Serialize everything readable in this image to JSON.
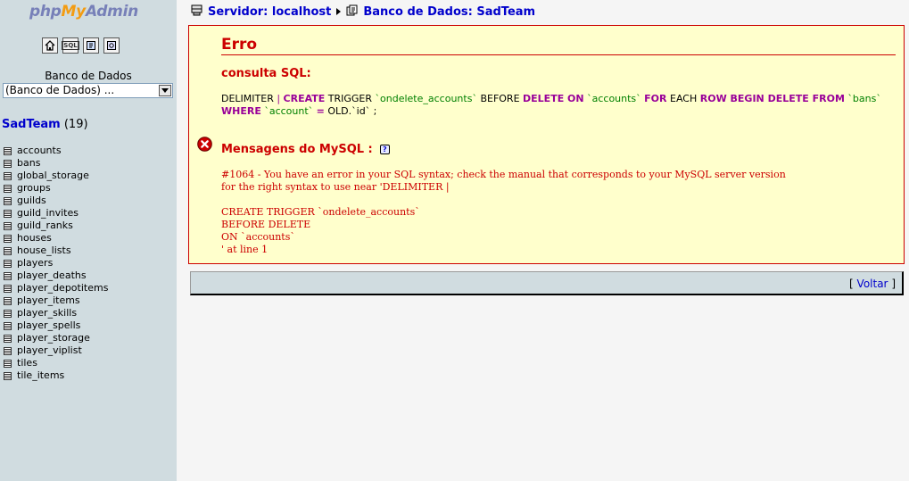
{
  "sidebar": {
    "logo": {
      "php": "php",
      "my": "My",
      "admin": "Admin"
    },
    "icons": [
      {
        "name": "home-icon",
        "label": ""
      },
      {
        "name": "sql-icon",
        "label": "SQL"
      },
      {
        "name": "query-window-icon",
        "label": ""
      },
      {
        "name": "docs-icon",
        "label": ""
      }
    ],
    "db_label": "Banco de Dados",
    "db_select_value": "(Banco de Dados) ...",
    "current_db_name": "SadTeam",
    "current_db_count": "(19)",
    "tables": [
      "accounts",
      "bans",
      "global_storage",
      "groups",
      "guilds",
      "guild_invites",
      "guild_ranks",
      "houses",
      "house_lists",
      "players",
      "player_deaths",
      "player_depotitems",
      "player_items",
      "player_skills",
      "player_spells",
      "player_storage",
      "player_viplist",
      "tiles",
      "tile_items"
    ]
  },
  "breadcrumb": {
    "server": "Servidor: localhost",
    "database": "Banco de Dados: SadTeam"
  },
  "error": {
    "title": "Erro",
    "sql_label": "consulta SQL:",
    "query_tokens": [
      {
        "t": "DELIMITER ",
        "c": "plain"
      },
      {
        "t": "| ",
        "c": "pipe"
      },
      {
        "t": "CREATE",
        "c": "kw"
      },
      {
        "t": " TRIGGER ",
        "c": "plain"
      },
      {
        "t": "`ondelete_accounts`",
        "c": "str"
      },
      {
        "t": " BEFORE ",
        "c": "plain"
      },
      {
        "t": "DELETE ON",
        "c": "kw"
      },
      {
        "t": " ",
        "c": "plain"
      },
      {
        "t": "`accounts`",
        "c": "str"
      },
      {
        "t": " ",
        "c": "plain"
      },
      {
        "t": "FOR",
        "c": "kw"
      },
      {
        "t": " EACH ",
        "c": "plain"
      },
      {
        "t": "ROW BEGIN DELETE FROM",
        "c": "kw"
      },
      {
        "t": " ",
        "c": "plain"
      },
      {
        "t": "`bans`",
        "c": "str"
      },
      {
        "t": " ",
        "c": "plain"
      },
      {
        "t": "WHERE",
        "c": "kw"
      },
      {
        "t": " ",
        "c": "plain"
      },
      {
        "t": "`account`",
        "c": "str"
      },
      {
        "t": " ",
        "c": "plain"
      },
      {
        "t": "=",
        "c": "kw"
      },
      {
        "t": " OLD.`id` ;",
        "c": "plain"
      }
    ],
    "mysql_label": "Mensagens do MySQL :",
    "help_label": "?",
    "mysql_message_lines": [
      "#1064 - You have an error in your SQL syntax; check the manual that corresponds to your MySQL server version",
      "for the right syntax to use near 'DELIMITER |",
      "",
      "CREATE TRIGGER `ondelete_accounts`",
      "BEFORE DELETE",
      "ON `accounts`",
      "' at line 1"
    ]
  },
  "back": {
    "open": "[ ",
    "label": "Voltar",
    "close": " ]"
  },
  "colors": {
    "sidebar_bg": "#d0dce0",
    "error_red": "#cc0000",
    "error_bg": "#ffffcc",
    "link_blue": "#0000cc"
  }
}
